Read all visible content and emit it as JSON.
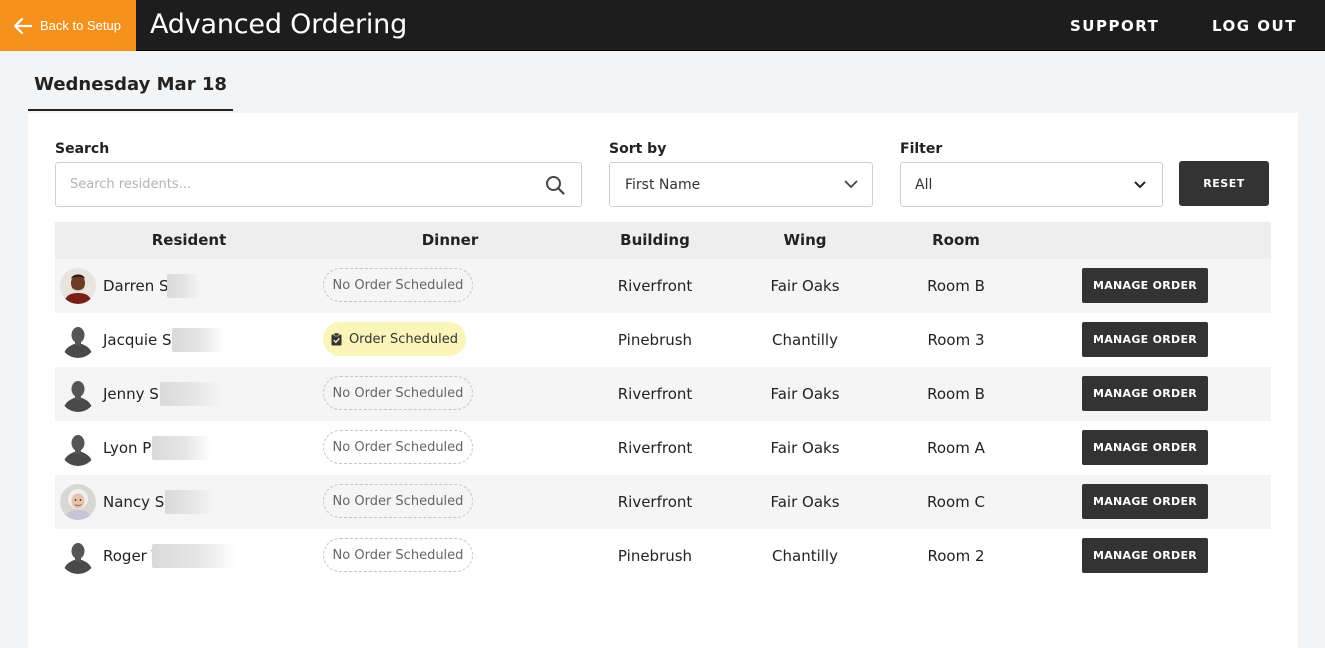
{
  "header": {
    "back_label": "Back to Setup",
    "title": "Advanced Ordering",
    "support_label": "SUPPORT",
    "logout_label": "LOG OUT",
    "accent_color": "#f4921d"
  },
  "date_tab": "Wednesday Mar 18",
  "controls": {
    "search_label": "Search",
    "search_placeholder": "Search residents...",
    "search_value": "",
    "sort_label": "Sort by",
    "sort_value": "First Name",
    "filter_label": "Filter",
    "filter_value": "All",
    "reset_label": "RESET"
  },
  "table": {
    "columns": [
      "Resident",
      "Dinner",
      "Building",
      "Wing",
      "Room"
    ],
    "action_label": "MANAGE ORDER",
    "rows": [
      {
        "name": "Darren S",
        "avatar": "photo-man",
        "dinner": "No Order Scheduled",
        "scheduled": false,
        "building": "Riverfront",
        "wing": "Fair Oaks",
        "room": "Room B"
      },
      {
        "name": "Jacquie S",
        "avatar": "silhouette",
        "dinner": "Order Scheduled",
        "scheduled": true,
        "building": "Pinebrush",
        "wing": "Chantilly",
        "room": "Room 3"
      },
      {
        "name": "Jenny S",
        "avatar": "silhouette",
        "dinner": "No Order Scheduled",
        "scheduled": false,
        "building": "Riverfront",
        "wing": "Fair Oaks",
        "room": "Room B"
      },
      {
        "name": "Lyon P",
        "avatar": "silhouette",
        "dinner": "No Order Scheduled",
        "scheduled": false,
        "building": "Riverfront",
        "wing": "Fair Oaks",
        "room": "Room A"
      },
      {
        "name": "Nancy Sr",
        "avatar": "photo-woman",
        "dinner": "No Order Scheduled",
        "scheduled": false,
        "building": "Riverfront",
        "wing": "Fair Oaks",
        "room": "Room C"
      },
      {
        "name": "Roger T",
        "avatar": "silhouette",
        "dinner": "No Order Scheduled",
        "scheduled": false,
        "building": "Pinebrush",
        "wing": "Chantilly",
        "room": "Room 2"
      }
    ]
  }
}
